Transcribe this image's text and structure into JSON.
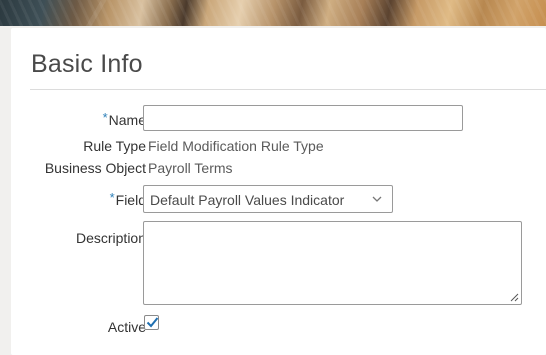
{
  "section": {
    "title": "Basic Info"
  },
  "form": {
    "required_marker": "*",
    "name": {
      "label": "Name",
      "value": "",
      "required": true
    },
    "rule_type": {
      "label": "Rule Type",
      "value": "Field Modification Rule Type"
    },
    "business_object": {
      "label": "Business Object",
      "value": "Payroll Terms"
    },
    "field": {
      "label": "Field",
      "value": "Default Payroll Values Indicator",
      "required": true,
      "icon": "chevron-down-icon"
    },
    "description": {
      "label": "Description",
      "value": ""
    },
    "active": {
      "label": "Active",
      "checked": true,
      "icon": "checkmark-icon"
    }
  },
  "colors": {
    "required_marker": "#2c7fb8",
    "checkmark": "#1f6fb0",
    "label_text": "#333333",
    "value_text": "#5a5a5a"
  }
}
